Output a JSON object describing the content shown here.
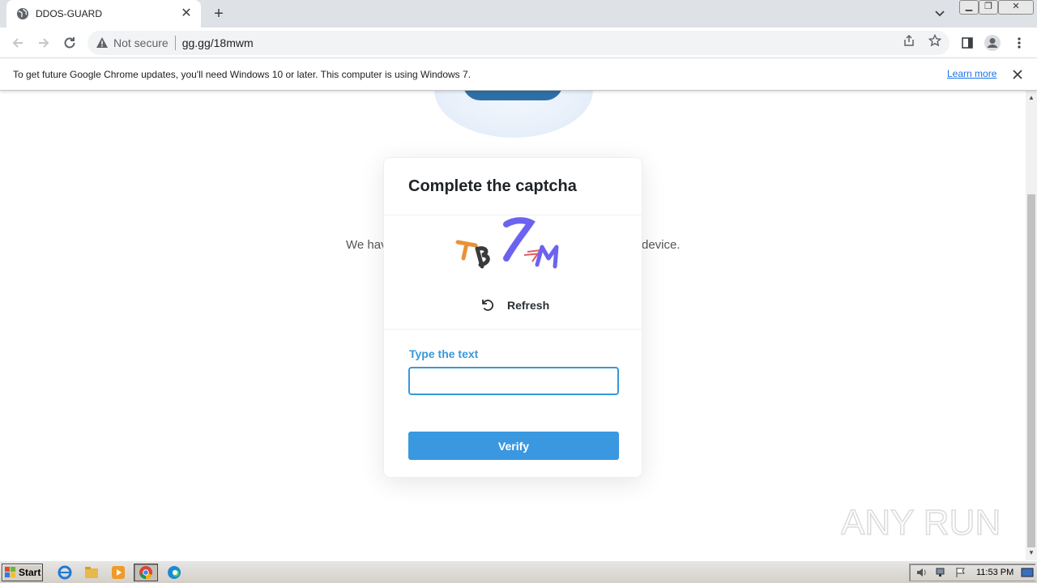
{
  "browser": {
    "tab": {
      "title": "DDOS-GUARD"
    },
    "address": {
      "security_label": "Not secure",
      "url": "gg.gg/18mwm"
    }
  },
  "infobar": {
    "message": "To get future Google Chrome updates, you'll need Windows 10 or later. This computer is using Windows 7.",
    "link": "Learn more"
  },
  "page": {
    "background_text_left": "We hav",
    "background_text_right": "device."
  },
  "captcha": {
    "title": "Complete the captcha",
    "refresh_label": "Refresh",
    "field_label": "Type the text",
    "input_value": "",
    "verify_label": "Verify",
    "accent_color": "#3a98d8"
  },
  "watermark": {
    "text": "ANY RUN"
  },
  "taskbar": {
    "start_label": "Start",
    "clock": "11:53 PM"
  }
}
